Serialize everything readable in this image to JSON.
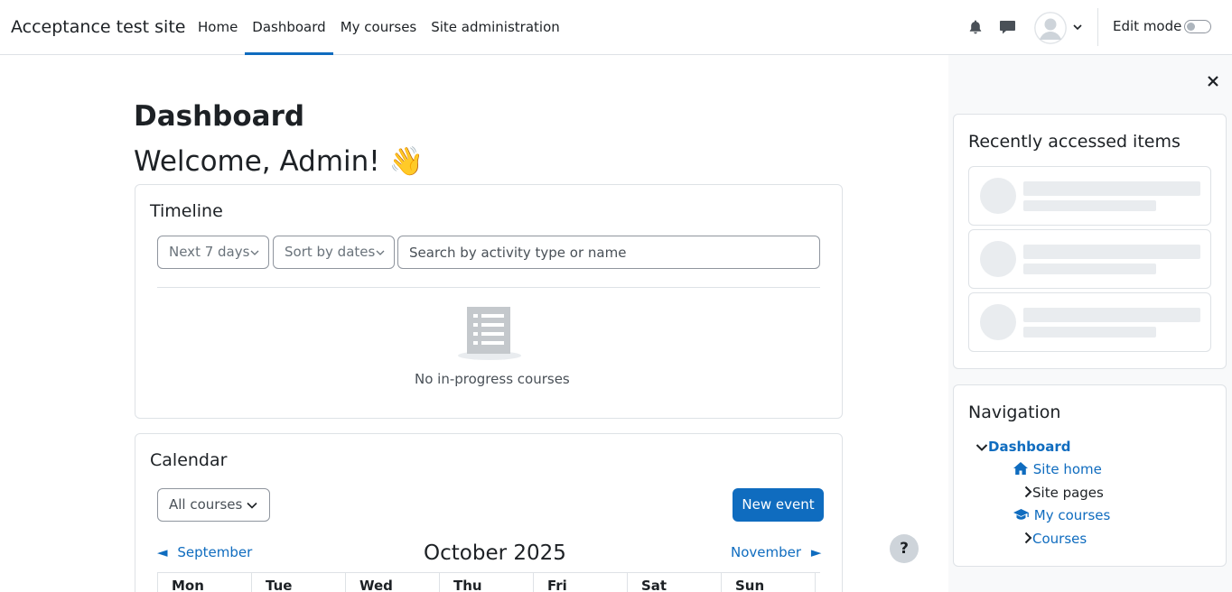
{
  "navbar": {
    "brand": "Acceptance test site",
    "links": [
      {
        "label": "Home",
        "active": false
      },
      {
        "label": "Dashboard",
        "active": true
      },
      {
        "label": "My courses",
        "active": false
      },
      {
        "label": "Site administration",
        "active": false
      }
    ],
    "edit_mode_label": "Edit mode",
    "edit_mode_on": false
  },
  "main": {
    "title": "Dashboard",
    "welcome": "Welcome, Admin! 👋"
  },
  "timeline": {
    "title": "Timeline",
    "filter_selected": "Next 7 days",
    "sort_selected": "Sort by dates",
    "search_placeholder": "Search by activity type or name",
    "empty_text": "No in-progress courses"
  },
  "calendar": {
    "title": "Calendar",
    "course_filter": "All courses",
    "new_event_label": "New event",
    "prev_month": "September",
    "next_month": "November",
    "current_month": "October 2025",
    "days": [
      "Mon",
      "Tue",
      "Wed",
      "Thu",
      "Fri",
      "Sat",
      "Sun"
    ]
  },
  "help": {
    "label": "?"
  },
  "drawer": {
    "recent": {
      "title": "Recently accessed items"
    },
    "navigation": {
      "title": "Navigation",
      "items": [
        {
          "label": "Dashboard",
          "icon": "chevron-down-icon"
        },
        {
          "label": "Site home",
          "icon": "home-icon"
        },
        {
          "label": "Site pages",
          "icon": "chevron-right-icon"
        },
        {
          "label": "My courses",
          "icon": "graduation-cap-icon"
        },
        {
          "label": "Courses",
          "icon": "chevron-right-icon"
        }
      ]
    }
  },
  "colors": {
    "accent": "#0f6cbf",
    "text": "#1d2125",
    "border": "#dee2e6",
    "drawer_bg": "#f8f9fa"
  }
}
